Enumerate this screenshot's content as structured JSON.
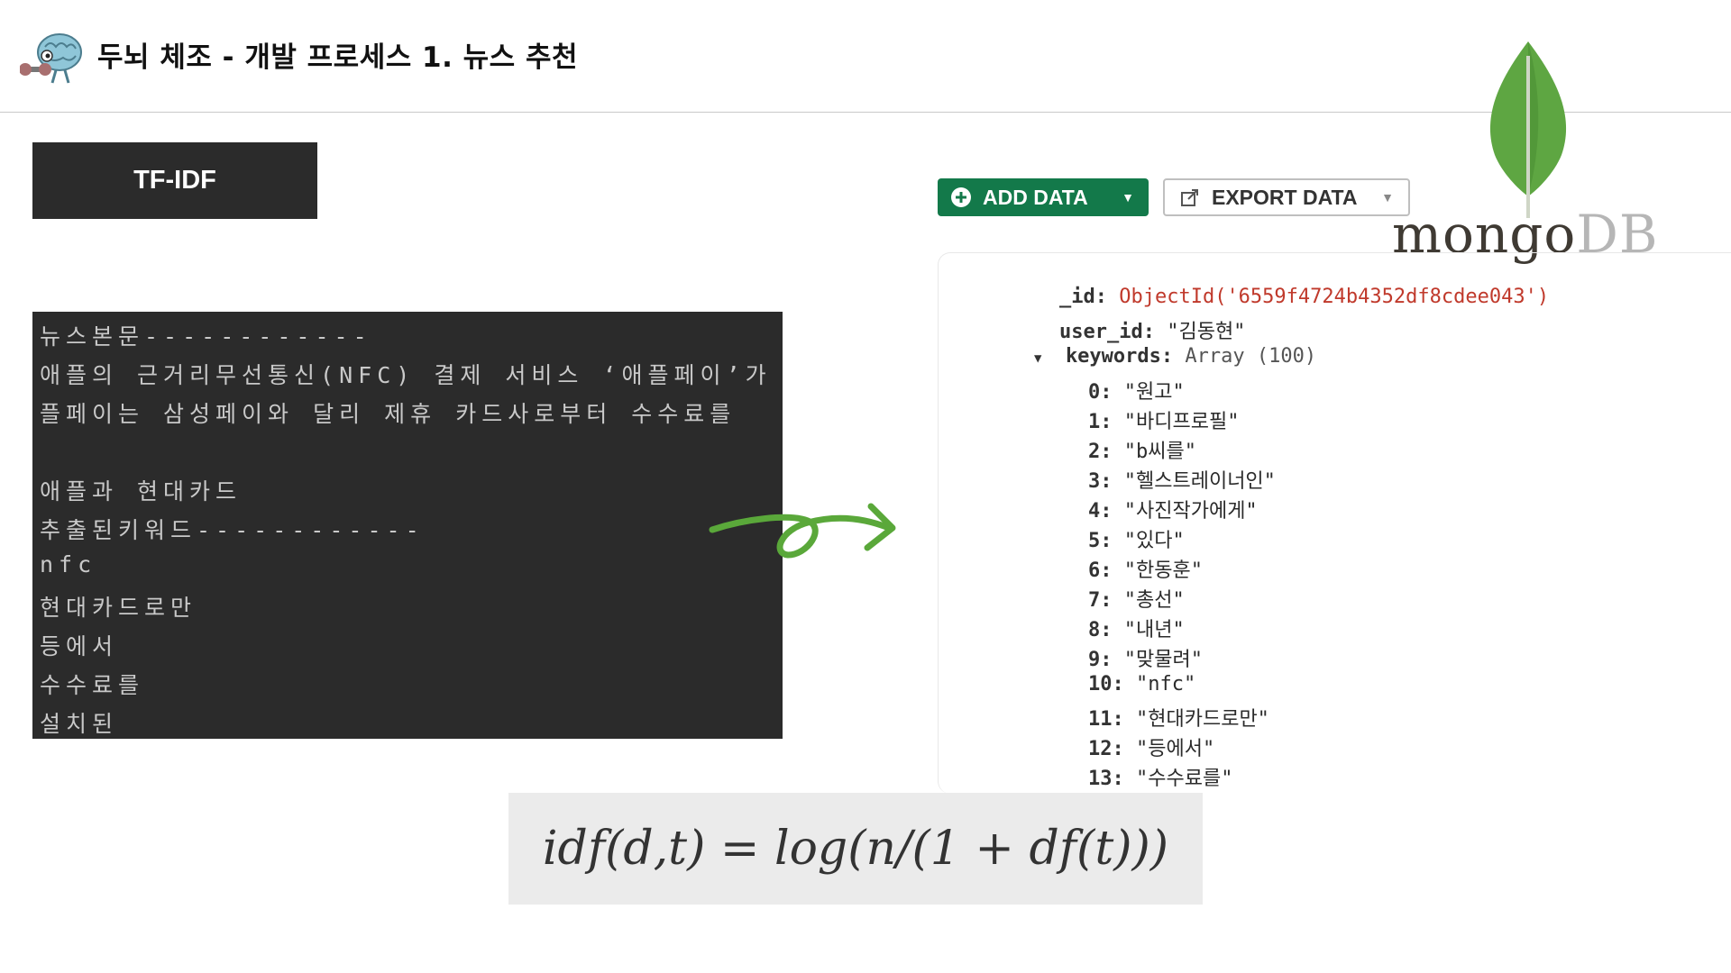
{
  "header": {
    "title": "두뇌 체조 - 개발 프로세스 1. 뉴스 추천",
    "mascot_icon": "brain-mascot-icon"
  },
  "tfidf_label": "TF-IDF",
  "terminal": {
    "lines": [
      "뉴스본문------------",
      "애플의 근거리무선통신(NFC) 결제 서비스 ‘애플페이’가",
      "플페이는 삼성페이와 달리 제휴 카드사로부터 수수료를",
      "",
      "애플과 현대카드",
      "추출된키워드------------",
      "nfc",
      "현대카드로만",
      "등에서",
      "수수료를",
      "설치된"
    ]
  },
  "mongo": {
    "add_data_label": "ADD DATA",
    "export_data_label": "EXPORT DATA",
    "logo_word": "mongo",
    "logo_db": "DB",
    "brand_green": "#13794a",
    "document": {
      "id_key": "_id:",
      "id_value": "ObjectId('6559f4724b4352df8cdee043')",
      "user_key": "user_id:",
      "user_value": "\"김동현\"",
      "keywords_key": "keywords:",
      "keywords_type": "Array (100)",
      "items": [
        {
          "index": "0:",
          "value": "\"원고\""
        },
        {
          "index": "1:",
          "value": "\"바디프로필\""
        },
        {
          "index": "2:",
          "value": "\"b씨를\""
        },
        {
          "index": "3:",
          "value": "\"헬스트레이너인\""
        },
        {
          "index": "4:",
          "value": "\"사진작가에게\""
        },
        {
          "index": "5:",
          "value": "\"있다\""
        },
        {
          "index": "6:",
          "value": "\"한동훈\""
        },
        {
          "index": "7:",
          "value": "\"총선\""
        },
        {
          "index": "8:",
          "value": "\"내년\""
        },
        {
          "index": "9:",
          "value": "\"맞물려\""
        },
        {
          "index": "10:",
          "value": "\"nfc\""
        },
        {
          "index": "11:",
          "value": "\"현대카드로만\""
        },
        {
          "index": "12:",
          "value": "\"등에서\""
        },
        {
          "index": "13:",
          "value": "\"수수료를\""
        }
      ]
    }
  },
  "formula": "idf(d,t) = log(n/(1 + df(t)))"
}
